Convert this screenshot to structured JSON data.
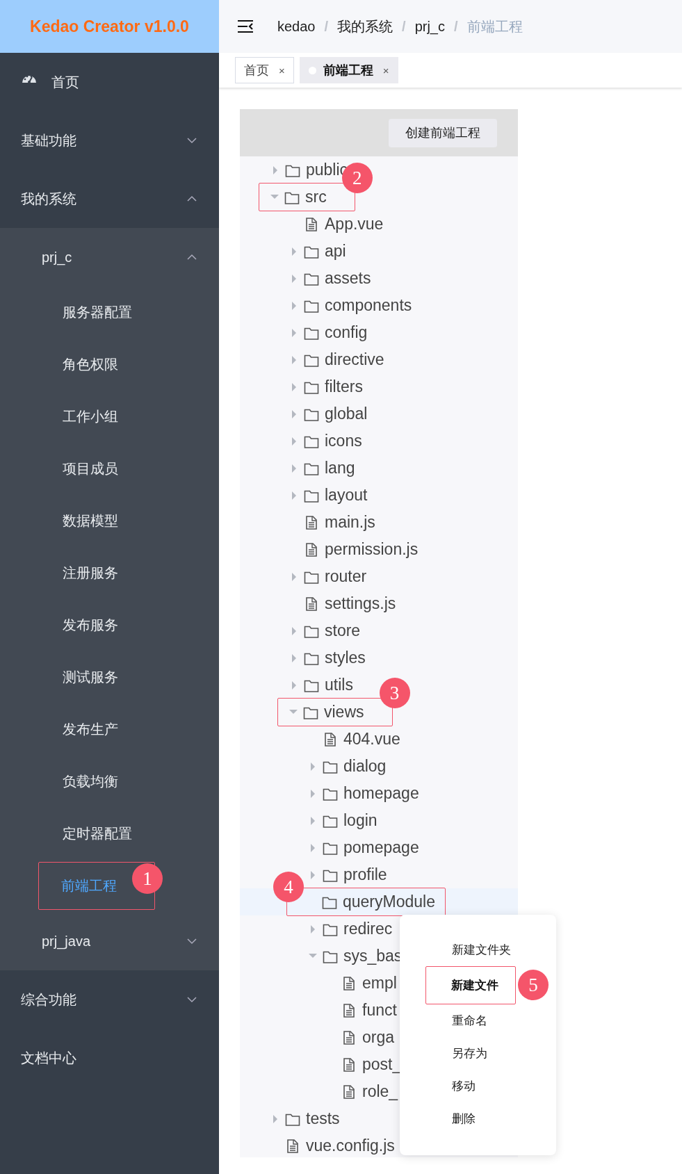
{
  "logo": {
    "title": "Kedao Creator v1.0.0"
  },
  "sidebar": {
    "items": [
      {
        "label": "首页",
        "kind": "link",
        "selected": false
      },
      {
        "label": "基础功能",
        "kind": "group",
        "expanded": false,
        "selected": false
      },
      {
        "label": "我的系统",
        "kind": "group",
        "expanded": true,
        "selected": false,
        "children": [
          {
            "label": "prj_c",
            "kind": "group",
            "expanded": true,
            "selected": false,
            "children": [
              {
                "label": "服务器配置",
                "kind": "link",
                "selected": false
              },
              {
                "label": "角色权限",
                "kind": "link",
                "selected": false
              },
              {
                "label": "工作小组",
                "kind": "link",
                "selected": false
              },
              {
                "label": "项目成员",
                "kind": "link",
                "selected": false
              },
              {
                "label": "数据模型",
                "kind": "link",
                "selected": false
              },
              {
                "label": "注册服务",
                "kind": "link",
                "selected": false
              },
              {
                "label": "发布服务",
                "kind": "link",
                "selected": false
              },
              {
                "label": "测试服务",
                "kind": "link",
                "selected": false
              },
              {
                "label": "发布生产",
                "kind": "link",
                "selected": false
              },
              {
                "label": "负载均衡",
                "kind": "link",
                "selected": false
              },
              {
                "label": "定时器配置",
                "kind": "link",
                "selected": false
              },
              {
                "label": "前端工程",
                "kind": "link",
                "selected": true,
                "callout": {
                  "number": "1"
                }
              }
            ]
          },
          {
            "label": "prj_java",
            "kind": "group",
            "expanded": false,
            "selected": false
          }
        ]
      },
      {
        "label": "综合功能",
        "kind": "group",
        "expanded": false,
        "selected": false
      },
      {
        "label": "文档中心",
        "kind": "link",
        "selected": false
      }
    ]
  },
  "breadcrumb": [
    {
      "label": "kedao",
      "current": false
    },
    {
      "separator": "/",
      "label": "我的系统",
      "current": false
    },
    {
      "separator": "/",
      "label": "prj_c",
      "current": false
    },
    {
      "separator": "/",
      "label": "前端工程",
      "current": true
    }
  ],
  "tabs": [
    {
      "label": "首页",
      "selected": false,
      "close": "×"
    },
    {
      "label": "前端工程",
      "selected": true,
      "close": "×"
    }
  ],
  "panel": {
    "create_button": "创建前端工程",
    "tree": [
      {
        "label": "public",
        "kind": "folder",
        "expanded": false,
        "selected": false
      },
      {
        "label": "src",
        "kind": "folder",
        "expanded": true,
        "selected": false,
        "callout": {
          "number": "2"
        },
        "children": [
          {
            "label": "App.vue",
            "kind": "file",
            "selected": false
          },
          {
            "label": "api",
            "kind": "folder",
            "expanded": false,
            "selected": false
          },
          {
            "label": "assets",
            "kind": "folder",
            "expanded": false,
            "selected": false
          },
          {
            "label": "components",
            "kind": "folder",
            "expanded": false,
            "selected": false
          },
          {
            "label": "config",
            "kind": "folder",
            "expanded": false,
            "selected": false
          },
          {
            "label": "directive",
            "kind": "folder",
            "expanded": false,
            "selected": false
          },
          {
            "label": "filters",
            "kind": "folder",
            "expanded": false,
            "selected": false
          },
          {
            "label": "global",
            "kind": "folder",
            "expanded": false,
            "selected": false
          },
          {
            "label": "icons",
            "kind": "folder",
            "expanded": false,
            "selected": false
          },
          {
            "label": "lang",
            "kind": "folder",
            "expanded": false,
            "selected": false
          },
          {
            "label": "layout",
            "kind": "folder",
            "expanded": false,
            "selected": false
          },
          {
            "label": "main.js",
            "kind": "file",
            "selected": false
          },
          {
            "label": "permission.js",
            "kind": "file",
            "selected": false
          },
          {
            "label": "router",
            "kind": "folder",
            "expanded": false,
            "selected": false
          },
          {
            "label": "settings.js",
            "kind": "file",
            "selected": false
          },
          {
            "label": "store",
            "kind": "folder",
            "expanded": false,
            "selected": false
          },
          {
            "label": "styles",
            "kind": "folder",
            "expanded": false,
            "selected": false
          },
          {
            "label": "utils",
            "kind": "folder",
            "expanded": false,
            "selected": false
          },
          {
            "label": "views",
            "kind": "folder",
            "expanded": true,
            "selected": false,
            "callout": {
              "number": "3"
            },
            "children": [
              {
                "label": "404.vue",
                "kind": "file",
                "selected": false
              },
              {
                "label": "dialog",
                "kind": "folder",
                "expanded": false,
                "selected": false
              },
              {
                "label": "homepage",
                "kind": "folder",
                "expanded": false,
                "selected": false
              },
              {
                "label": "login",
                "kind": "folder",
                "expanded": false,
                "selected": false
              },
              {
                "label": "pomepage",
                "kind": "folder",
                "expanded": false,
                "selected": false
              },
              {
                "label": "profile",
                "kind": "folder",
                "expanded": false,
                "selected": false
              },
              {
                "label": "queryModule",
                "kind": "folder",
                "selected": true,
                "callout": {
                  "number": "4"
                }
              },
              {
                "label": "redirec",
                "kind": "folder",
                "expanded": false,
                "selected": false
              },
              {
                "label": "sys_bas",
                "kind": "folder",
                "expanded": true,
                "selected": false,
                "children": [
                  {
                    "label": "empl",
                    "kind": "file",
                    "selected": false
                  },
                  {
                    "label": "funct",
                    "kind": "file",
                    "selected": false
                  },
                  {
                    "label": "orga",
                    "kind": "file",
                    "selected": false
                  },
                  {
                    "label": "post_",
                    "kind": "file",
                    "selected": false
                  },
                  {
                    "label": "role_",
                    "kind": "file",
                    "selected": false
                  }
                ]
              }
            ]
          }
        ]
      },
      {
        "label": "tests",
        "kind": "folder",
        "expanded": false,
        "selected": false
      },
      {
        "label": "vue.config.js",
        "kind": "file",
        "selected": false
      }
    ],
    "context_menu": [
      {
        "label": "新建文件夹",
        "selected": false
      },
      {
        "label": "新建文件",
        "selected": true,
        "callout": {
          "number": "5"
        }
      },
      {
        "label": "重命名",
        "selected": false
      },
      {
        "label": "另存为",
        "selected": false
      },
      {
        "label": "移动",
        "selected": false
      },
      {
        "label": "删除",
        "selected": false
      }
    ]
  }
}
